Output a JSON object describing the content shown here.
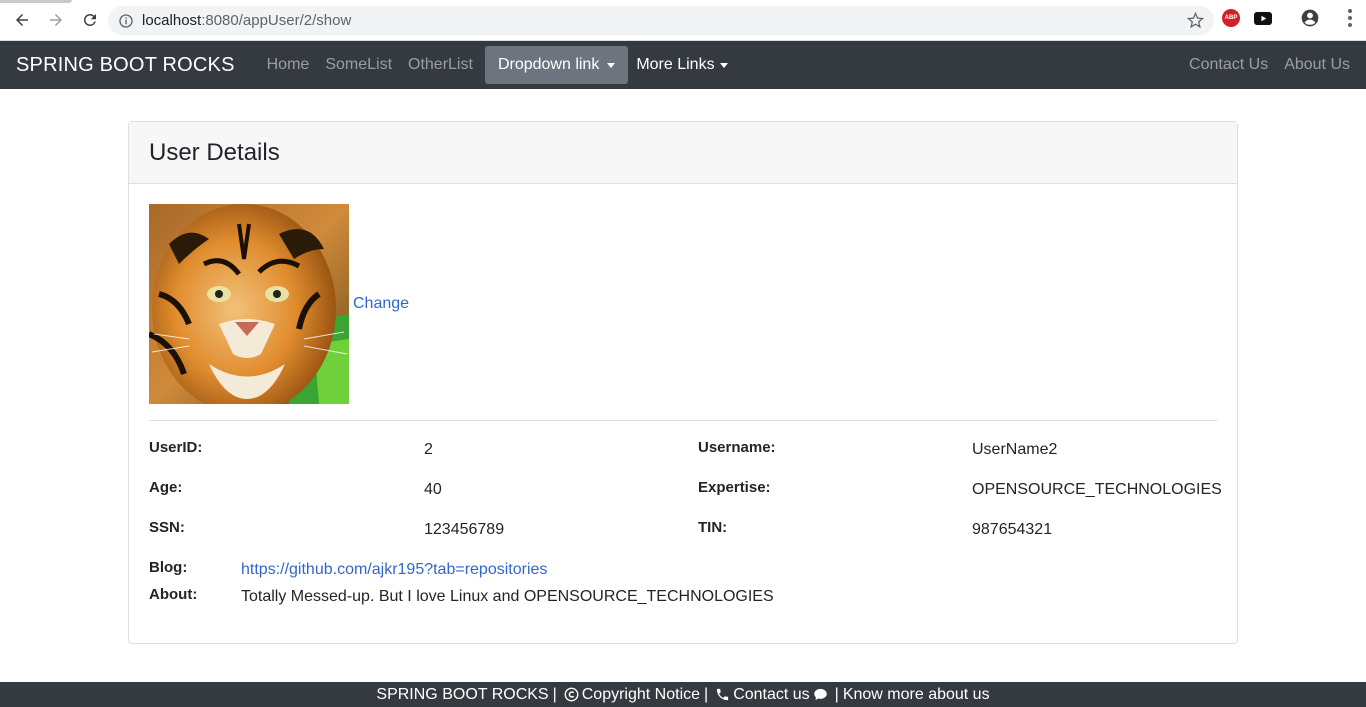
{
  "browser": {
    "url_host": "localhost",
    "url_rest": ":8080/appUser/2/show"
  },
  "navbar": {
    "brand": "SPRING BOOT ROCKS",
    "links": [
      "Home",
      "SomeList",
      "OtherList"
    ],
    "dropdown_label": "Dropdown link",
    "more_links_label": "More Links",
    "right_links": [
      "Contact Us",
      "About Us"
    ]
  },
  "card": {
    "title": "User Details",
    "change_label": "Change",
    "fields": {
      "userid_label": "UserID:",
      "userid_value": "2",
      "username_label": "Username:",
      "username_value": "UserName2",
      "age_label": "Age:",
      "age_value": "40",
      "expertise_label": "Expertise:",
      "expertise_value": "OPENSOURCE_TECHNOLOGIES",
      "ssn_label": "SSN:",
      "ssn_value": "123456789",
      "tin_label": "TIN:",
      "tin_value": "987654321",
      "blog_label": "Blog:",
      "blog_value": "https://github.com/ajkr195?tab=repositories",
      "about_label": "About:",
      "about_value": "Totally Messed-up. But I love Linux and OPENSOURCE_TECHNOLOGIES"
    }
  },
  "footer": {
    "brand": "SPRING BOOT ROCKS",
    "sep": "|",
    "copyright": "Copyright Notice",
    "contact": "Contact us",
    "know_more": "Know more about us"
  },
  "colors": {
    "navbar_bg": "#343a40",
    "link": "#3366cc",
    "dropdown_active_bg": "#6c757d"
  }
}
